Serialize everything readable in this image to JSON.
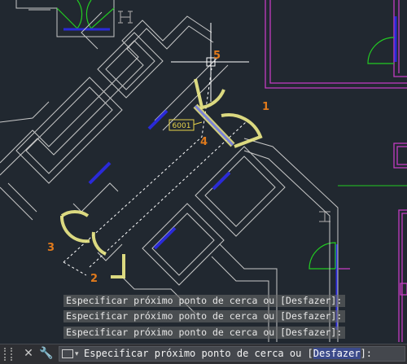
{
  "drawing": {
    "room_tag": "6001",
    "point_labels": [
      "1",
      "2",
      "3",
      "4",
      "5"
    ],
    "colors": {
      "background": "#212830",
      "walls": "#c8c8c8",
      "magenta_walls": "#c23cc2",
      "doors": "#22cc22",
      "windows": "#2a2ad8",
      "highlight": "#f0ec8a",
      "labels": "#e07a1c",
      "tag": "#e8d44a",
      "fence": "#ffffff"
    }
  },
  "command_history": [
    {
      "prefix": "Especificar próximo ponto de cerca ou [",
      "keyword": "Desfazer",
      "suffix": "]:"
    },
    {
      "prefix": "Especificar próximo ponto de cerca ou [",
      "keyword": "Desfazer",
      "suffix": "]:"
    },
    {
      "prefix": "Especificar próximo ponto de cerca ou [",
      "keyword": "Desfazer",
      "suffix": "]:"
    }
  ],
  "command_line": {
    "close_icon": "close-icon",
    "customize_icon": "wrench-icon",
    "prompt_prefix": "Especificar próximo ponto de cerca ou [",
    "prompt_keyword": "Desfazer",
    "prompt_suffix": "]:"
  }
}
